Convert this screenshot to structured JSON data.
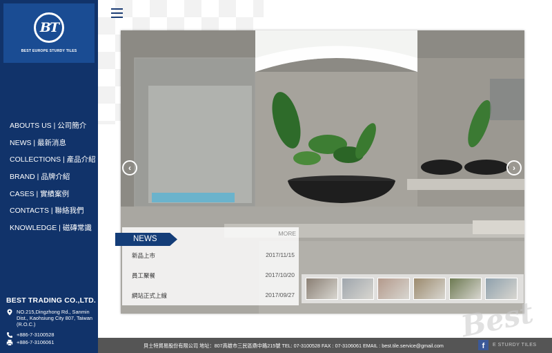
{
  "logo": {
    "mark": "BT",
    "tagline": "BEST EUROPE STURDY TILES"
  },
  "nav": [
    "ABOUTS US | 公司簡介",
    "NEWS | 最新消息",
    "COLLECTIONS | 產品介紹",
    "BRAND | 品牌介紹",
    "CASES | 實績案例",
    "CONTACTS | 聯絡我們",
    "KNOWLEDGE | 磁磚常識"
  ],
  "company": {
    "name": "BEST TRADING CO.,LTD.",
    "address": "NO.215,Dingzhong Rd., Sanmin Dist., Kaohsiung City 807, Taiwan (R.O.C.)",
    "phone": "+886-7-3100528",
    "fax": "+886-7-3106061"
  },
  "slider": {
    "prev": "‹",
    "next": "›"
  },
  "news": {
    "tab": "NEWS",
    "more": "MORE",
    "items": [
      {
        "title": "新品上市",
        "date": "2017/11/15"
      },
      {
        "title": "員工聚餐",
        "date": "2017/10/20"
      },
      {
        "title": "網站正式上線",
        "date": "2017/09/27"
      }
    ]
  },
  "thumbnails": [
    "#8a7f74",
    "#9fa6ad",
    "#b49a8c",
    "#9c8b6e",
    "#6d7a52",
    "#8fa1ad"
  ],
  "watermark": "Best",
  "footer": {
    "text": "貝士特貿易股份有限公司  地址：807高雄市三民區鼎中路215號 TEL: 07-3100528   FAX : 07-3106061   EMAIL : best.tile.service@gmail.com",
    "facebook": "f",
    "brand": "E STURDY TILES"
  },
  "colors": {
    "sidebar": "#11336a",
    "logo_box": "#1a4c93",
    "news_tab": "#143d78",
    "footer": "#555555"
  }
}
